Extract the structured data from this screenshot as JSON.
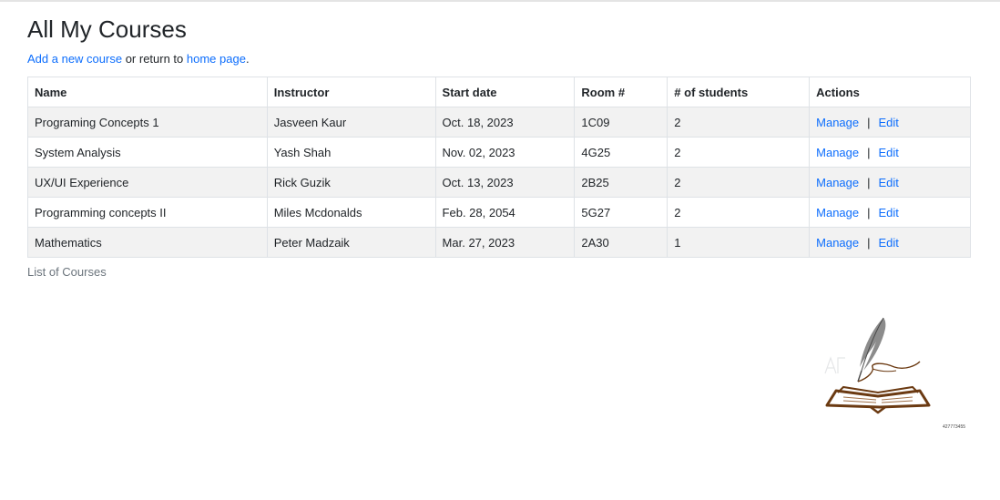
{
  "page": {
    "title": "All My Courses",
    "add_course_link": "Add a new course",
    "middle_text": " or return to ",
    "home_link": "home page",
    "period": ".",
    "caption": "List of Courses"
  },
  "table": {
    "headers": {
      "name": "Name",
      "instructor": "Instructor",
      "start_date": "Start date",
      "room": "Room #",
      "students": "# of students",
      "actions": "Actions"
    },
    "rows": [
      {
        "name": "Programing Concepts 1",
        "instructor": "Jasveen Kaur",
        "start_date": "Oct. 18, 2023",
        "room": "1C09",
        "students": "2",
        "manage": "Manage",
        "sep": "|",
        "edit": "Edit"
      },
      {
        "name": "System Analysis",
        "instructor": "Yash Shah",
        "start_date": "Nov. 02, 2023",
        "room": "4G25",
        "students": "2",
        "manage": "Manage",
        "sep": "|",
        "edit": "Edit"
      },
      {
        "name": "UX/UI Experience",
        "instructor": "Rick Guzik",
        "start_date": "Oct. 13, 2023",
        "room": "2B25",
        "students": "2",
        "manage": "Manage",
        "sep": "|",
        "edit": "Edit"
      },
      {
        "name": "Programming concepts II",
        "instructor": "Miles Mcdonalds",
        "start_date": "Feb. 28, 2054",
        "room": "5G27",
        "students": "2",
        "manage": "Manage",
        "sep": "|",
        "edit": "Edit"
      },
      {
        "name": "Mathematics",
        "instructor": "Peter Madzaik",
        "start_date": "Mar. 27, 2023",
        "room": "2A30",
        "students": "1",
        "manage": "Manage",
        "sep": "|",
        "edit": "Edit"
      }
    ]
  },
  "logo": {
    "icon": "book-quill-icon",
    "stock_id": "427773455"
  },
  "colors": {
    "link": "#0d6efd",
    "stripe": "#f2f2f2",
    "border": "#dee2e6",
    "book_brown": "#6b3a12"
  }
}
